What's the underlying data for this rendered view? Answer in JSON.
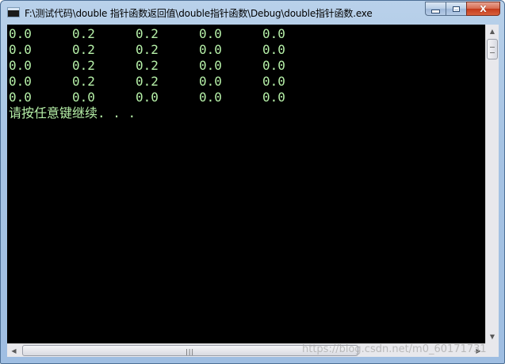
{
  "window": {
    "title": "F:\\测试代码\\double 指针函数返回值\\double指针函数\\Debug\\double指针函数.exe",
    "minimize_label": "",
    "maximize_label": "",
    "close_label": "X"
  },
  "console": {
    "rows": [
      [
        "0.0",
        "0.2",
        "0.2",
        "0.0",
        "0.0"
      ],
      [
        "0.0",
        "0.2",
        "0.2",
        "0.0",
        "0.0"
      ],
      [
        "0.0",
        "0.2",
        "0.2",
        "0.0",
        "0.0"
      ],
      [
        "0.0",
        "0.2",
        "0.2",
        "0.0",
        "0.0"
      ],
      [
        "0.0",
        "0.0",
        "0.0",
        "0.0",
        "0.0"
      ]
    ],
    "prompt": "请按任意键继续. . .",
    "text_color": "#b6f0a8",
    "background_color": "#000000"
  },
  "scrollbars": {
    "horizontal_grip": "|||"
  },
  "watermark": "https://blog.csdn.net/m0_60171731"
}
